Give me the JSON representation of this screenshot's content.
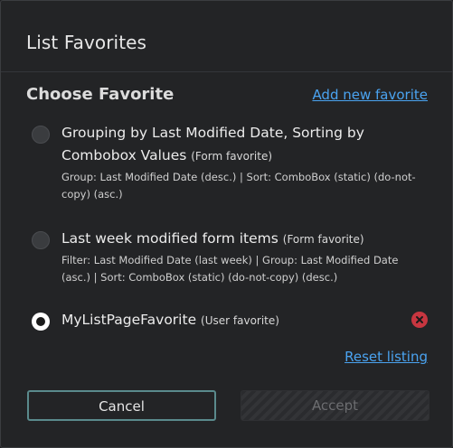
{
  "dialog": {
    "title": "List Favorites",
    "section_title": "Choose Favorite",
    "add_link": "Add new favorite",
    "reset_link": "Reset listing"
  },
  "options": [
    {
      "name": "Grouping by Last Modified Date, Sorting by Combobox Values",
      "kind": "(Form favorite)",
      "description": "Group: Last Modified Date (desc.) | Sort: ComboBox (static) (do-not-copy) (asc.)",
      "selected": false
    },
    {
      "name": "Last week modified form items",
      "kind": "(Form favorite)",
      "description": "Filter: Last Modified Date (last week) | Group: Last Modified Date (asc.) | Sort: ComboBox (static) (do-not-copy) (desc.)",
      "selected": false
    },
    {
      "name": "MyListPageFavorite",
      "kind": "(User favorite)",
      "description": "",
      "selected": true
    }
  ],
  "buttons": {
    "cancel": "Cancel",
    "accept": "Accept"
  },
  "colors": {
    "link": "#4aa3f0",
    "remove": "#c73640",
    "cancel_border": "#5a8a8c"
  }
}
